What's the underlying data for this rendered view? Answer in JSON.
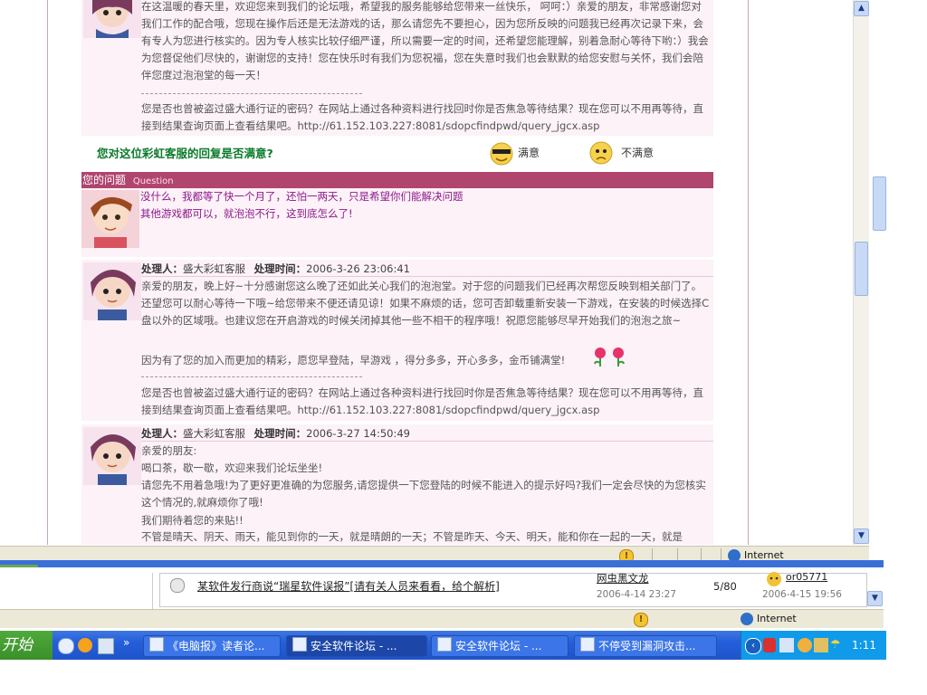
{
  "thread": {
    "reply1_text": "在这温暖的春天里，欢迎您来到我们的论坛哦，希望我的服务能够给您带来一丝快乐， 呵呵：）亲爱的朋友，非常感谢您对我们工作的配合哦，您现在操作后还是无法游戏的话，那么请您先不要担心，因为您所反映的问题我已经再次记录下来，会有专人为您进行核实的。因为专人核实比较仔细严谨，所以需要一定的时间，还希望您能理解，别着急耐心等待下哟：）我会为您督促他们尽快的，谢谢您的支持！您在快乐时有我们为您祝福，您在失意时我们也会默默的给您安慰与关怀，我们会陪伴您度过泡泡堂的每一天！",
    "notice": "您是否也曾被盗过盛大通行证的密码？在网站上通过各种资料进行找回时你是否焦急等待结果？现在您可以不用再等待，直接到结果查询页面上查看结果吧。http://61.152.103.227:8081/sdopcfindpwd/query_jgcx.asp",
    "satisfaction_question": "您对这位彩虹客服的回复是否满意?",
    "satisfied_label": "满意",
    "unsatisfied_label": "不满意",
    "question_header": "您的问题",
    "question_header_en": "Question",
    "question_line1": "没什么，我都等了快一个月了，还怕一两天，只是希望你们能解决问题",
    "question_line2": "其他游戏都可以，就泡泡不行，这到底怎么了!",
    "handler_label": "处理人：",
    "handler_name": "盛大彩虹客服",
    "time_label": "处理时间：",
    "reply2_time": "2006-3-26 23:06:41",
    "reply2_text": "亲爱的朋友，晚上好~十分感谢您这么晚了还如此关心我们的泡泡堂。对于您的问题我们已经再次帮您反映到相关部门了。还望您可以耐心等待一下哦~给您带来不便还请见谅！如果不麻烦的话，您可否卸载重新安装一下游戏，在安装的时候选择C盘以外的区域哦。也建议您在开启游戏的时候关闭掉其他一些不相干的程序哦！祝愿您能够尽早开始我们的泡泡之旅~",
    "reply2_extra": "因为有了您的加入而更加的精彩，愿您早登陆，早游戏 ，得分多多，开心多多，金币铺满堂!",
    "reply3_time": "2006-3-27 14:50:49",
    "reply3_l1": "亲爱的朋友:",
    "reply3_l2": "喝口茶，歇一歇，欢迎来我们论坛坐坐!",
    "reply3_l3": "请您先不用着急哦!为了更好更准确的为您服务,请您提供一下您登陆的时候不能进入的提示好吗?我们一定会尽快的为您核实这个情况的,就麻烦你了哦!",
    "reply3_l4": "我们期待着您的来贴!!",
    "reply3_l5": "不管是晴天、阴天、雨天，能见到你的一天，就是晴朗的一天；不管是昨天、今天、明天，能和你在一起的一天，就是"
  },
  "status_front": {
    "zone": "Internet"
  },
  "background_window": {
    "topic": "某软件发行商说“瑞星软件误报”[请有关人员来看看，给个解析]",
    "author": "网虫黑文龙",
    "date1": "2006-4-14 23:27",
    "count": "5/80",
    "last_user": "or05771",
    "date2": "2006-4-15 19:56",
    "zone": "Internet"
  },
  "taskbar": {
    "start_label": "开始",
    "tasks": [
      "《电脑报》读者论...",
      "安全软件论坛 - ...",
      "安全软件论坛 - ...",
      "不停受到漏洞攻击..."
    ],
    "clock": "1:11"
  },
  "colors": {
    "accent": "#b0456e",
    "taskbar": "#245edb",
    "purple_text": "#8a1a8a"
  }
}
